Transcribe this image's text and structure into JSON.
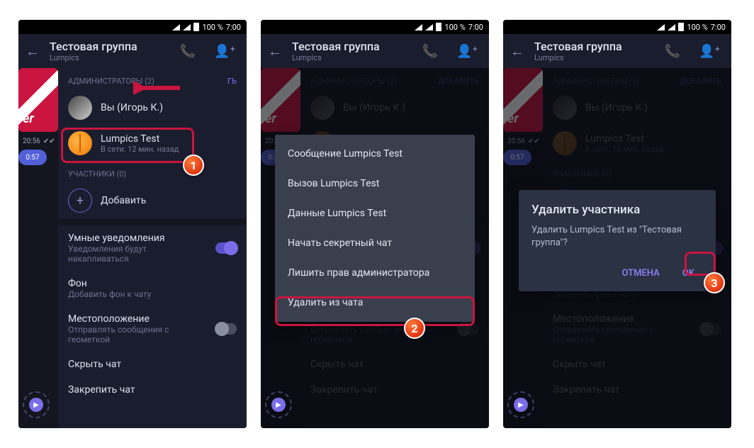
{
  "statusbar": {
    "battery": "100 %",
    "time": "7:00"
  },
  "header": {
    "title": "Тестовая группа",
    "subtitle": "Lumpics"
  },
  "leftstrip": {
    "time1": "20:56",
    "bubble": "0:57"
  },
  "admins": {
    "label": "АДМИНИСТРАТОРЫ (2)",
    "add_action_trunc": "ГЬ",
    "add_action": "ДОБАВИТЬ",
    "you": "Вы (Игорь К.)",
    "user2_name": "Lumpics Test",
    "user2_status": "В сети: 12 мин. назад"
  },
  "participants": {
    "label": "УЧАСТНИКИ (0)",
    "add": "Добавить"
  },
  "settings": {
    "smart_title": "Умные уведомления",
    "smart_desc": "Уведомления будут накапливаться",
    "bg_title": "Фон",
    "bg_desc": "Добавить фон к чату",
    "loc_title": "Местоположение",
    "loc_desc": "Отправлять сообщения с геометкой",
    "hide": "Скрыть чат",
    "pin": "Закрепить чат"
  },
  "context_menu": {
    "msg": "Сообщение Lumpics Test",
    "call": "Вызов Lumpics Test",
    "data": "Данные Lumpics Test",
    "secret": "Начать секретный чат",
    "demote": "Лишить прав администратора",
    "remove": "Удалить из чата"
  },
  "dialog": {
    "title": "Удалить участника",
    "message": "Удалить Lumpics Test из \"Тестовая группа\"?",
    "cancel": "ОТМЕНА",
    "ok": "OK"
  },
  "badges": {
    "b1": "1",
    "b2": "2",
    "b3": "3"
  }
}
